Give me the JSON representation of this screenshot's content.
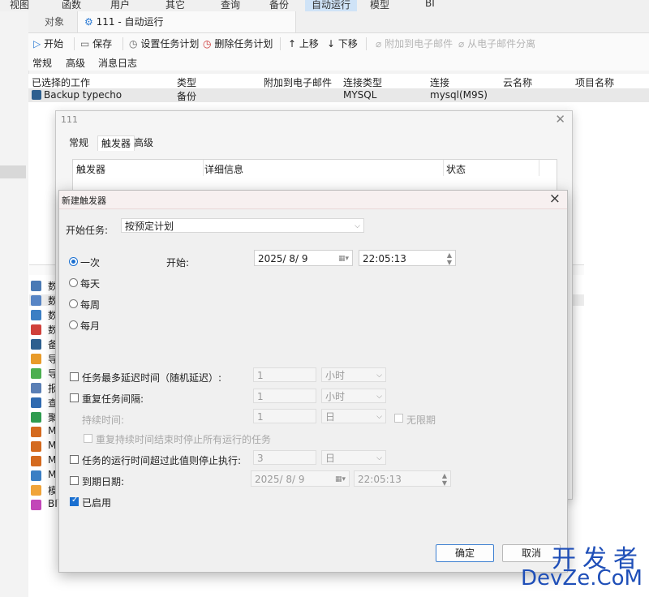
{
  "top_menu": [
    "视图",
    "函数",
    "用户",
    "其它",
    "查询",
    "备份",
    "自动运行",
    "模型",
    "BI"
  ],
  "tabs": {
    "object": "对象",
    "active": "111 - 自动运行"
  },
  "toolbar": {
    "start": "开始",
    "save": "保存",
    "set_schedule": "设置任务计划",
    "delete_schedule": "删除任务计划",
    "move_up": "上移",
    "move_down": "下移",
    "attach_email": "附加到电子邮件",
    "detach_email": "从电子邮件分离"
  },
  "sub_tabs": [
    "常规",
    "高级",
    "消息日志"
  ],
  "list": {
    "headers": [
      "已选择的工作",
      "类型",
      "附加到电子邮件",
      "连接类型",
      "连接",
      "云名称",
      "项目名称"
    ],
    "row": {
      "job": "Backup typecho",
      "type": "备份",
      "conn_type": "MYSQL",
      "conn": "mysql(M9S)"
    }
  },
  "left_items": [
    "数",
    "数",
    "数",
    "数",
    "备",
    "导",
    "导",
    "报",
    "查",
    "聚",
    "M",
    "M",
    "M",
    "M",
    "模",
    "BI"
  ],
  "dialog111": {
    "title": "111",
    "tabs": [
      "常规",
      "触发器",
      "高级"
    ],
    "table_headers": [
      "触发器",
      "详细信息",
      "状态"
    ]
  },
  "new_trigger": {
    "title": "新建触发器",
    "start_task_label": "开始任务:",
    "start_task_value": "按预定计划",
    "freq": [
      "一次",
      "每天",
      "每周",
      "每月"
    ],
    "start_label": "开始:",
    "start_date": "2025/  8/  9",
    "start_time": "22:05:13",
    "delay_label": "任务最多延迟时间（随机延迟）:",
    "delay_value": "1",
    "delay_unit": "小时",
    "repeat_label": "重复任务间隔:",
    "repeat_value": "1",
    "repeat_unit": "小时",
    "duration_label": "持续时间:",
    "duration_value": "1",
    "duration_unit": "日",
    "unlimited_label": "无限期",
    "stop_all_label": "重复持续时间结束时停止所有运行的任务",
    "stop_if_label": "任务的运行时间超过此值则停止执行:",
    "stop_if_value": "3",
    "stop_if_unit": "日",
    "expire_label": "到期日期:",
    "expire_date": "2025/  8/  9",
    "expire_time": "22:05:13",
    "enabled_label": "已启用",
    "ok": "确定",
    "cancel": "取消"
  },
  "watermark": {
    "line1": "开发者",
    "line2": "DevZe.CoM"
  }
}
